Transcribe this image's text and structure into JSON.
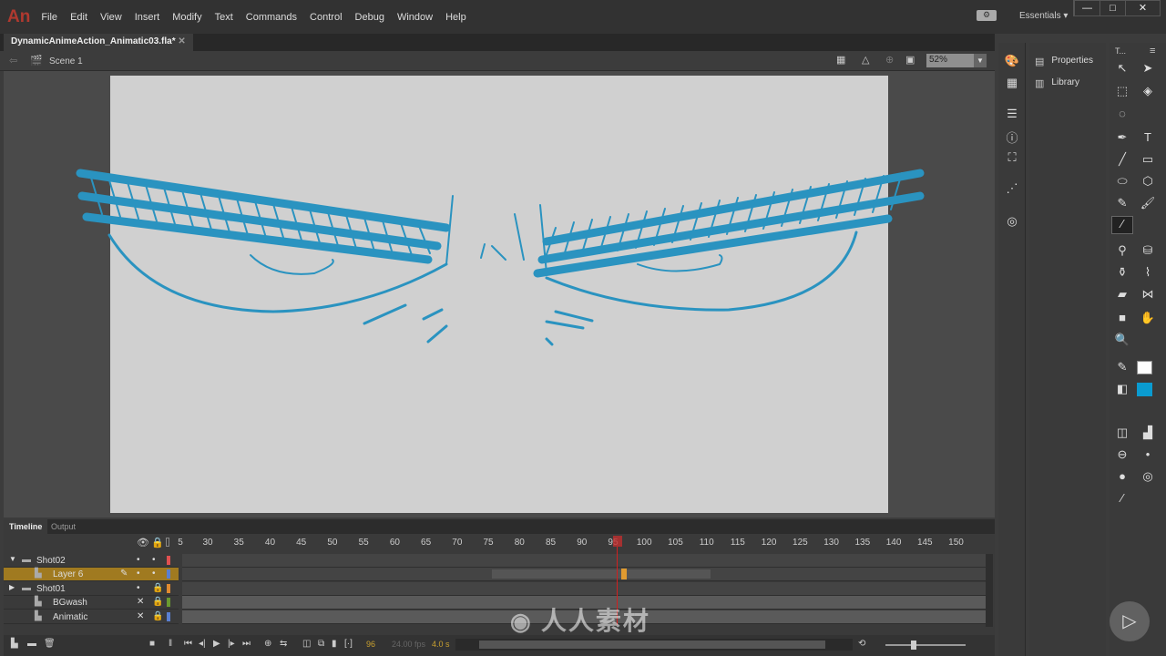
{
  "app": {
    "logo": "An",
    "menu": [
      "File",
      "Edit",
      "View",
      "Insert",
      "Modify",
      "Text",
      "Commands",
      "Control",
      "Debug",
      "Window",
      "Help"
    ],
    "workspace": "Essentials"
  },
  "document": {
    "tab_title": "DynamicAnimeAction_Animatic03.fla*",
    "scene": "Scene 1",
    "zoom": "52%"
  },
  "stage": {
    "stroke_color": "#2a93c0",
    "background": "#d0d0d0"
  },
  "panels": {
    "properties": "Properties",
    "library": "Library",
    "tools_tab": "T..."
  },
  "timeline": {
    "tabs": [
      "Timeline",
      "Output"
    ],
    "ruler": [
      "5",
      "30",
      "35",
      "40",
      "45",
      "50",
      "55",
      "60",
      "65",
      "70",
      "75",
      "80",
      "85",
      "90",
      "95",
      "100",
      "105",
      "110",
      "115",
      "120",
      "125",
      "130",
      "135",
      "140",
      "145",
      "150"
    ],
    "current_frame": "96",
    "fps": "24.00 fps",
    "time": "4.0 s",
    "layers": [
      {
        "name": "Shot02",
        "type": "folder",
        "expanded": true,
        "color": "#e05050"
      },
      {
        "name": "Layer 6",
        "type": "layer",
        "selected": true,
        "color": "#5a7fd0"
      },
      {
        "name": "Shot01",
        "type": "folder",
        "expanded": false,
        "color": "#e08a30"
      },
      {
        "name": "BGwash",
        "type": "layer",
        "color": "#6a9a30"
      },
      {
        "name": "Animatic",
        "type": "layer",
        "color": "#5a7fd0"
      }
    ]
  },
  "watermark": "人人素材"
}
